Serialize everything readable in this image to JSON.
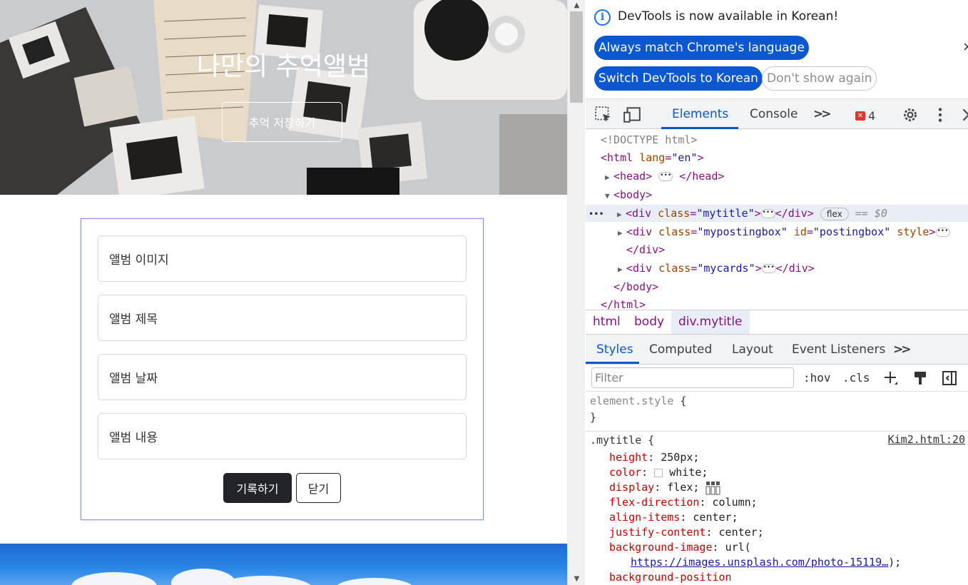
{
  "page": {
    "hero": {
      "title": "나만의 추억앨범",
      "button_label": "추억 저장하기"
    },
    "form": {
      "fields": [
        "앨범 이미지",
        "앨범 제목",
        "앨범 날짜",
        "앨범 내용"
      ],
      "submit_label": "기록하기",
      "close_label": "닫기"
    }
  },
  "devtools": {
    "infobar": {
      "message": "DevTools is now available in Korean!",
      "btn_match": "Always match Chrome's language",
      "btn_switch": "Switch DevTools to Korean",
      "btn_dont_show": "Don't show again",
      "close": "×"
    },
    "tabs": {
      "elements": "Elements",
      "console": "Console",
      "more": ">>",
      "error_count": "4"
    },
    "dom": {
      "doctype": "<!DOCTYPE html>",
      "html_open_tag": "<html",
      "html_lang_attr": "lang",
      "html_lang_val": "\"en\"",
      "html_close_bracket": ">",
      "head_open": "<head>",
      "head_close": "</head>",
      "body_open": "<body>",
      "div_open": "<div",
      "class_attr": "class",
      "id_attr": "id",
      "style_attr": "style",
      "mytitle_val": "\"mytitle\"",
      "postingbox_val": "\"mypostingbox\"",
      "postingbox_id_val": "\"postingbox\"",
      "mycards_val": "\"mycards\"",
      "div_close": "</div>",
      "gt": ">",
      "flex_badge": "flex",
      "selected_marker": "== $0",
      "row_dots": "•••",
      "body_close": "</body>",
      "html_close": "</html>"
    },
    "breadcrumbs": [
      "html",
      "body",
      "div.mytitle"
    ],
    "subtabs": [
      "Styles",
      "Computed",
      "Layout",
      "Event Listeners",
      ">>"
    ],
    "filter": {
      "placeholder": "Filter",
      "hov": ":hov",
      "cls": ".cls"
    },
    "styles": {
      "element_style": "element.style",
      "open_brace": " {",
      "close_brace": "}",
      "selector": ".mytitle",
      "source": "Kim2.html:20",
      "props": [
        {
          "name": "height",
          "value": "250px;"
        },
        {
          "name": "color",
          "value": "white;"
        },
        {
          "name": "display",
          "value": "flex;"
        },
        {
          "name": "flex-direction",
          "value": "column;"
        },
        {
          "name": "align-items",
          "value": "center;"
        },
        {
          "name": "justify-content",
          "value": "center;"
        },
        {
          "name": "background-image",
          "value": "url("
        }
      ],
      "url_text": "https://images.unsplash.com/photo-15119…",
      "url_close": ");",
      "next_prop": "background-position",
      "colon": ":"
    }
  }
}
